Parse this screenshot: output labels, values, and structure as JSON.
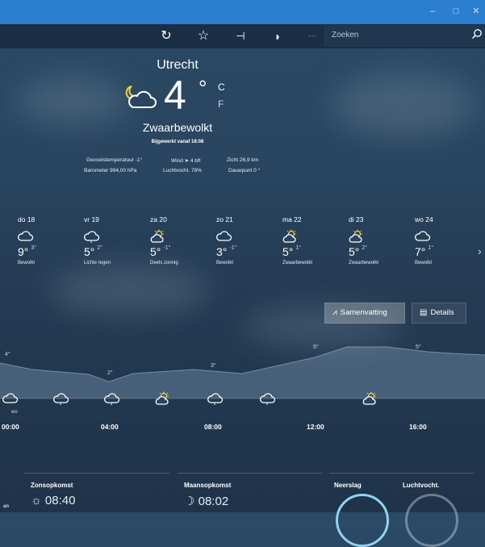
{
  "window": {
    "minimize": "–",
    "maximize": "□",
    "close": "✕"
  },
  "toolbar": {
    "refresh_icon": "↻",
    "favorite_icon": "☆",
    "pin_icon": "⊣",
    "dark_mode_icon": "◗",
    "more_icon": "···",
    "search_placeholder": "Zoeken"
  },
  "current": {
    "city": "Utrecht",
    "temp": "4",
    "deg": "°",
    "unit_c": "C",
    "unit_f": "F",
    "condition": "Zwaarbewolkt",
    "updated": "Bijgewerkt vanaf 18:08",
    "feels_like": "Gevoelstemperatuur  -1°",
    "wind": "Wind  ➤ 4 bft",
    "visibility": "Zicht  26,9 km",
    "barometer": "Barometer  994,00 hPa",
    "humidity": "Luchtvocht.  78%",
    "dewpoint": "Dauwpunt  0 °"
  },
  "forecast": [
    {
      "day": "do 18",
      "high": "9°",
      "low": "3°",
      "cond": "Bewolkt",
      "icon": "cloud"
    },
    {
      "day": "vr 19",
      "high": "5°",
      "low": "2°",
      "cond": "Lichte regen",
      "icon": "rain"
    },
    {
      "day": "za 20",
      "high": "5°",
      "low": "-1°",
      "cond": "Deels zonnig",
      "icon": "partly-sunny"
    },
    {
      "day": "zo 21",
      "high": "3°",
      "low": "-1°",
      "cond": "Bewolkt",
      "icon": "cloud"
    },
    {
      "day": "ma 22",
      "high": "5°",
      "low": "1°",
      "cond": "Zwaarbewolkt",
      "icon": "partly-sunny"
    },
    {
      "day": "di 23",
      "high": "5°",
      "low": "2°",
      "cond": "Zwaarbewolkt",
      "icon": "partly-sunny"
    },
    {
      "day": "wo 24",
      "high": "7°",
      "low": "1°",
      "cond": "Bewolkt",
      "icon": "cloud"
    }
  ],
  "next_arrow": "›",
  "view_buttons": {
    "summary": "Samenvatting",
    "details": "Details"
  },
  "hourly_chart": {
    "labels": [
      "4°",
      "2°",
      "3°",
      "5°",
      "5°"
    ],
    "times": [
      "00:00",
      "04:00",
      "08:00",
      "12:00",
      "16:00"
    ],
    "wo_label": "wo"
  },
  "bottom": {
    "sunrise_title": "Zonsopkomst",
    "sunrise_time": "08:40",
    "moonrise_title": "Maansopkomst",
    "moonrise_time": "08:02",
    "precip_title": "Neerslag",
    "humidity_title": "Luchtvocht.",
    "left_cut": "an"
  }
}
